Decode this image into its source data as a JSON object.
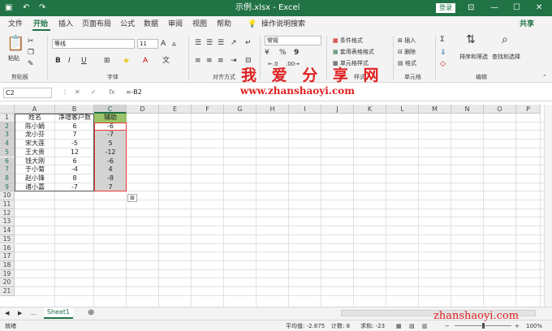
{
  "titlebar": {
    "title": "示例.xlsx  -  Excel",
    "login": "登录",
    "undo": "↶",
    "redo": "↷",
    "min": "—",
    "max": "☐",
    "close": "✕"
  },
  "menu": {
    "items": [
      "文件",
      "开始",
      "插入",
      "页面布局",
      "公式",
      "数据",
      "审阅",
      "视图",
      "帮助"
    ],
    "tell": "操作说明搜索",
    "share": "共享"
  },
  "ribbon": {
    "paste": "粘贴",
    "font_name": "等线",
    "font_size": "11",
    "bold": "B",
    "italic": "I",
    "underline": "U",
    "number_format": "常规",
    "cond_format": "条件格式",
    "table_format": "套用表格格式",
    "cell_style": "单元格样式",
    "insert": "插入",
    "delete": "删除",
    "format": "格式",
    "sort_filter": "排序和筛选",
    "find_select": "查找和选择",
    "groups": {
      "clipboard": "剪贴板",
      "font": "字体",
      "align": "对齐方式",
      "styles": "样式",
      "cells": "单元格",
      "editing": "编辑"
    }
  },
  "formula": {
    "name_box": "C2",
    "fx": "fx",
    "value": "=-B2"
  },
  "grid": {
    "columns": [
      "A",
      "B",
      "C",
      "D",
      "E",
      "F",
      "G",
      "H",
      "I",
      "J",
      "K",
      "L",
      "M",
      "N",
      "O",
      "P"
    ],
    "rows": [
      "1",
      "2",
      "3",
      "4",
      "5",
      "6",
      "7",
      "8",
      "9",
      "10",
      "11",
      "12",
      "13",
      "14",
      "15",
      "16",
      "17",
      "18",
      "19",
      "20",
      "21"
    ],
    "headers": [
      "姓名",
      "净增客户数",
      "辅助"
    ],
    "data": [
      [
        "陈小娟",
        "6",
        "-6"
      ],
      [
        "龙小芬",
        "7",
        "-7"
      ],
      [
        "宋大莲",
        "-5",
        "5"
      ],
      [
        "王大贵",
        "12",
        "-12"
      ],
      [
        "钱大刚",
        "6",
        "-6"
      ],
      [
        "于小菊",
        "-4",
        "4"
      ],
      [
        "赵小锋",
        "8",
        "-8"
      ],
      [
        "诸小嘉",
        "-7",
        "7"
      ]
    ]
  },
  "watermark": {
    "line1": "我 爱 分 享 网",
    "line2": "www.zhanshaoyi.com",
    "line3": "zhanshaoyi.com"
  },
  "tabs": {
    "sheet": "Sheet1",
    "add": "⊕"
  },
  "status": {
    "ready": "就绪",
    "avg": "平均值: -2.875",
    "count": "计数: 8",
    "sum": "求和: -23",
    "zoom": "100%"
  }
}
